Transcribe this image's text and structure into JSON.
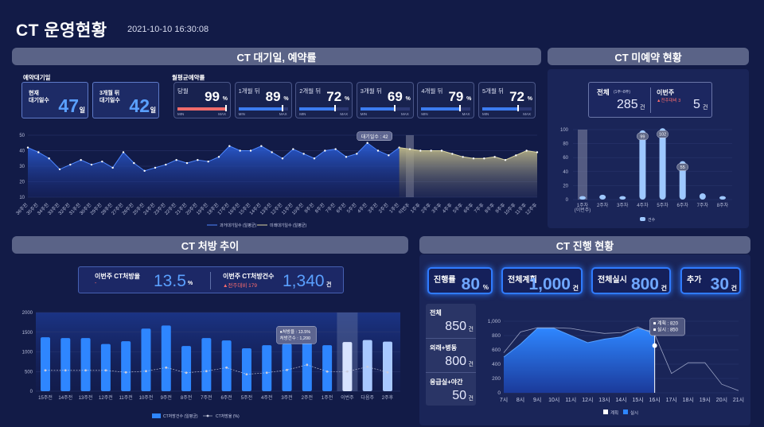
{
  "header": {
    "title": "CT 운영현황",
    "datetime": "2021-10-10 16:30:08"
  },
  "sections": {
    "waiting": "CT 대기일, 예약률",
    "unbooked": "CT 미예약 현황",
    "prescription": "CT 처방 추이",
    "progress": "CT 진행 현황"
  },
  "waiting": {
    "label_wait": "예약대기일",
    "label_rate": "월평균예약률",
    "current_label": "현재\n대기일수",
    "current_value": "47",
    "current_unit": "일",
    "future_label": "3개월 뒤\n대기일수",
    "future_value": "42",
    "future_unit": "일",
    "min": "MIN",
    "max": "MAX",
    "gauges": [
      {
        "label": "당월",
        "value": "99",
        "unit": "%",
        "fill": 0.99,
        "color": "#ef6b6b"
      },
      {
        "label": "1개월 뒤",
        "value": "89",
        "unit": "%",
        "fill": 0.89,
        "color": "#3c7cf0"
      },
      {
        "label": "2개월 뒤",
        "value": "72",
        "unit": "%",
        "fill": 0.72,
        "color": "#3c7cf0"
      },
      {
        "label": "3개월 뒤",
        "value": "69",
        "unit": "%",
        "fill": 0.69,
        "color": "#3c7cf0"
      },
      {
        "label": "4개월 뒤",
        "value": "79",
        "unit": "%",
        "fill": 0.79,
        "color": "#3c7cf0"
      },
      {
        "label": "5개월 뒤",
        "value": "72",
        "unit": "%",
        "fill": 0.72,
        "color": "#3c7cf0"
      }
    ],
    "tooltip": "대기일수 : 42",
    "legend": [
      "과거대기일수 (일평균)",
      "미래대기일수 (일평균)"
    ]
  },
  "unbooked": {
    "total_label": "전체",
    "total_sub": "(1주~8주)",
    "total_value": "285",
    "total_unit": "건",
    "week_label": "이번주",
    "week_sub": "▲전주대비 3",
    "week_value": "5",
    "week_unit": "건",
    "legend": "건수"
  },
  "prescription": {
    "rate_label": "이번주 CT처방율",
    "rate_value": "13.5",
    "rate_unit": "%",
    "rate_sub": "-",
    "count_label": "이번주 CT처방건수",
    "count_sub": "▲전주대비 179",
    "count_value": "1,340",
    "count_unit": "건",
    "tooltip": [
      "●처방율 : 13.5%",
      "처방건수 : 1,200"
    ],
    "legend": [
      "CT처방건수 (일평균)",
      "CT처방율 (%)"
    ]
  },
  "progress": {
    "cards": [
      {
        "title": "진행률",
        "value": "80",
        "unit": "%"
      },
      {
        "title": "전체계획",
        "value": "1,000",
        "unit": "건"
      },
      {
        "title": "전체실시",
        "value": "800",
        "unit": "건"
      },
      {
        "title": "추가",
        "value": "30",
        "unit": "건"
      }
    ],
    "side": [
      {
        "label": "전체",
        "value": "850",
        "unit": "건"
      },
      {
        "label": "외래+병동",
        "value": "800",
        "unit": "건"
      },
      {
        "label": "응급실+야간",
        "value": "50",
        "unit": "건"
      }
    ],
    "tooltip": [
      "■ 계획 : 820",
      "■ 실시 : 850"
    ],
    "legend": [
      "계획",
      "실시"
    ]
  },
  "chart_data": [
    {
      "type": "area",
      "id": "waiting-days",
      "categories": [
        "36주전",
        "35주전",
        "34주전",
        "33주전",
        "32주전",
        "31주전",
        "30주전",
        "29주전",
        "28주전",
        "27주전",
        "26주전",
        "25주전",
        "24주전",
        "23주전",
        "22주전",
        "21주전",
        "20주전",
        "19주전",
        "18주전",
        "17주전",
        "16주전",
        "15주전",
        "14주전",
        "13주전",
        "12주전",
        "11주전",
        "10주전",
        "9주전",
        "8주전",
        "7주전",
        "6주전",
        "5주전",
        "4주전",
        "3주전",
        "2주전",
        "1주전",
        "이번주",
        "1주후",
        "2주후",
        "3주후",
        "4주후",
        "5주후",
        "6주후",
        "7주후",
        "8주후",
        "9주후",
        "10주후",
        "11주후",
        "12주후"
      ],
      "series": [
        {
          "name": "과거대기일수 (일평균)",
          "values": [
            42,
            39,
            35,
            28,
            31,
            34,
            31,
            33,
            29,
            39,
            32,
            27,
            29,
            31,
            34,
            32,
            34,
            33,
            36,
            43,
            40,
            40,
            43,
            39,
            35,
            41,
            38,
            35,
            40,
            41,
            36,
            38,
            45,
            40,
            37,
            42,
            null,
            null,
            null,
            null,
            null,
            null,
            null,
            null,
            null,
            null,
            null,
            null,
            null
          ]
        },
        {
          "name": "미래대기일수 (일평균)",
          "values": [
            null,
            null,
            null,
            null,
            null,
            null,
            null,
            null,
            null,
            null,
            null,
            null,
            null,
            null,
            null,
            null,
            null,
            null,
            null,
            null,
            null,
            null,
            null,
            null,
            null,
            null,
            null,
            null,
            null,
            null,
            null,
            null,
            null,
            null,
            null,
            null,
            41,
            40,
            40,
            40,
            38,
            36,
            35,
            35,
            36,
            34,
            37,
            40,
            39
          ]
        }
      ],
      "ylim": [
        10,
        50
      ],
      "yticks": [
        10,
        20,
        30,
        40,
        50
      ]
    },
    {
      "type": "bar",
      "id": "unbooked-weeks",
      "categories": [
        "1주차\n(이번주)",
        "2주차",
        "3주차",
        "4주차",
        "5주차",
        "6주차",
        "7주차",
        "8주차"
      ],
      "values": [
        5,
        7,
        5,
        99,
        102,
        55,
        9,
        5
      ],
      "ylim": [
        0,
        100
      ],
      "yticks": [
        0,
        20,
        40,
        60,
        80,
        100
      ],
      "labels": [
        "",
        "",
        "",
        "99",
        "102",
        "55",
        "",
        ""
      ]
    },
    {
      "type": "bar",
      "id": "prescription-trend",
      "categories": [
        "15주전",
        "14주전",
        "13주전",
        "12주전",
        "11주전",
        "10주전",
        "9주전",
        "8주전",
        "7주전",
        "6주전",
        "5주전",
        "4주전",
        "3주전",
        "2주전",
        "1주전",
        "이번주",
        "다음주",
        "2주후"
      ],
      "series": [
        {
          "name": "CT처방건수 (일평균)",
          "values": [
            1370,
            1350,
            1350,
            1200,
            1270,
            1590,
            1670,
            1150,
            1350,
            1290,
            1090,
            1170,
            1200,
            1330,
            1170,
            1250,
            1300,
            1260
          ]
        },
        {
          "name": "CT처방율 (%)",
          "values": [
            530,
            530,
            530,
            530,
            480,
            510,
            600,
            470,
            510,
            600,
            430,
            470,
            540,
            670,
            500,
            500,
            620,
            480
          ]
        }
      ],
      "ylim": [
        0,
        2000
      ],
      "yticks": [
        0,
        500,
        1000,
        1500,
        2000
      ]
    },
    {
      "type": "area",
      "id": "progress-hourly",
      "categories": [
        "7시",
        "8시",
        "9시",
        "10시",
        "11시",
        "12시",
        "13시",
        "14시",
        "15시",
        "16시",
        "17시",
        "18시",
        "19시",
        "20시",
        "21시"
      ],
      "series": [
        {
          "name": "계획",
          "values": [
            560,
            850,
            910,
            910,
            900,
            860,
            830,
            840,
            920,
            820,
            270,
            420,
            420,
            120,
            30
          ]
        },
        {
          "name": "실시",
          "values": [
            500,
            680,
            900,
            900,
            800,
            700,
            750,
            780,
            900,
            850,
            null,
            null,
            null,
            null,
            null
          ]
        }
      ],
      "ylim": [
        0,
        1000
      ],
      "yticks": [
        "0",
        "200",
        "400",
        "600",
        "800",
        "1,000"
      ]
    }
  ]
}
